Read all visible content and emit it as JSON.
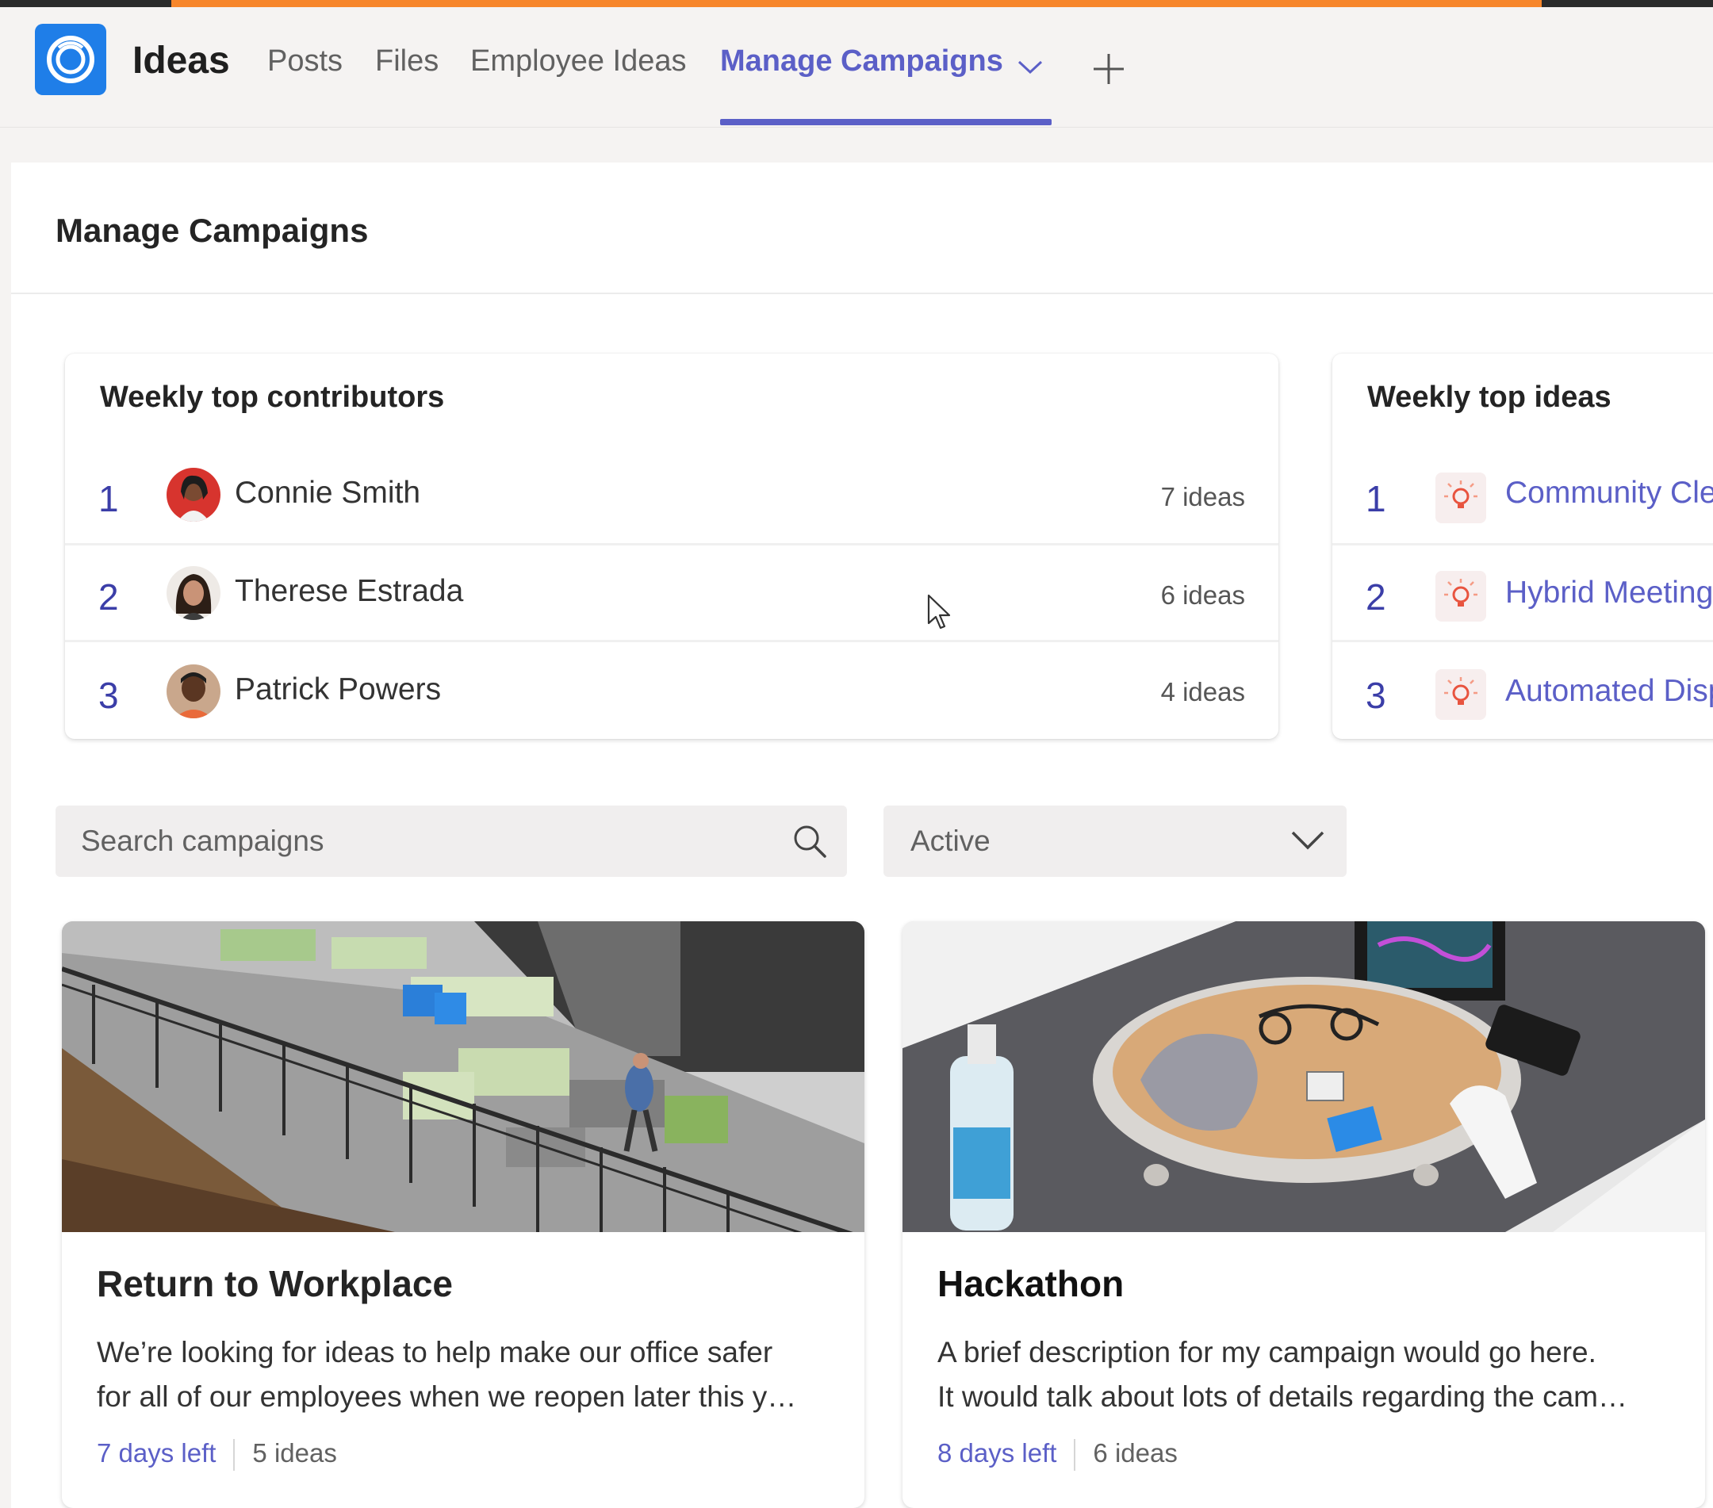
{
  "header": {
    "app_name": "Ideas",
    "tabs": [
      {
        "label": "Posts"
      },
      {
        "label": "Files"
      },
      {
        "label": "Employee Ideas"
      },
      {
        "label": "Manage Campaigns",
        "active": true
      }
    ]
  },
  "page": {
    "title": "Manage Campaigns"
  },
  "contributors": {
    "title": "Weekly top contributors",
    "items": [
      {
        "rank": "1",
        "name": "Connie Smith",
        "count": "7 ideas"
      },
      {
        "rank": "2",
        "name": "Therese Estrada",
        "count": "6 ideas"
      },
      {
        "rank": "3",
        "name": "Patrick Powers",
        "count": "4 ideas"
      }
    ]
  },
  "top_ideas": {
    "title": "Weekly top ideas",
    "items": [
      {
        "rank": "1",
        "label": "Community Cle"
      },
      {
        "rank": "2",
        "label": "Hybrid Meeting"
      },
      {
        "rank": "3",
        "label": "Automated Disp"
      }
    ]
  },
  "search": {
    "placeholder": "Search campaigns"
  },
  "filter": {
    "selected": "Active"
  },
  "campaigns": [
    {
      "title": "Return to Workplace",
      "desc_line1": "We’re looking for ideas to help make our office safer",
      "desc_line2": "for all of our employees when we reopen later this y…",
      "days_left": "7 days left",
      "ideas": "5 ideas"
    },
    {
      "title": "Hackathon",
      "desc_line1": "A brief description for my campaign would go here.",
      "desc_line2": "It would talk about lots of details regarding the cam…",
      "days_left": "8 days left",
      "ideas": "6 ideas"
    }
  ],
  "colors": {
    "accent": "#5b5fc7",
    "progress": "#f7862b",
    "app_icon": "#1f7ee8"
  }
}
